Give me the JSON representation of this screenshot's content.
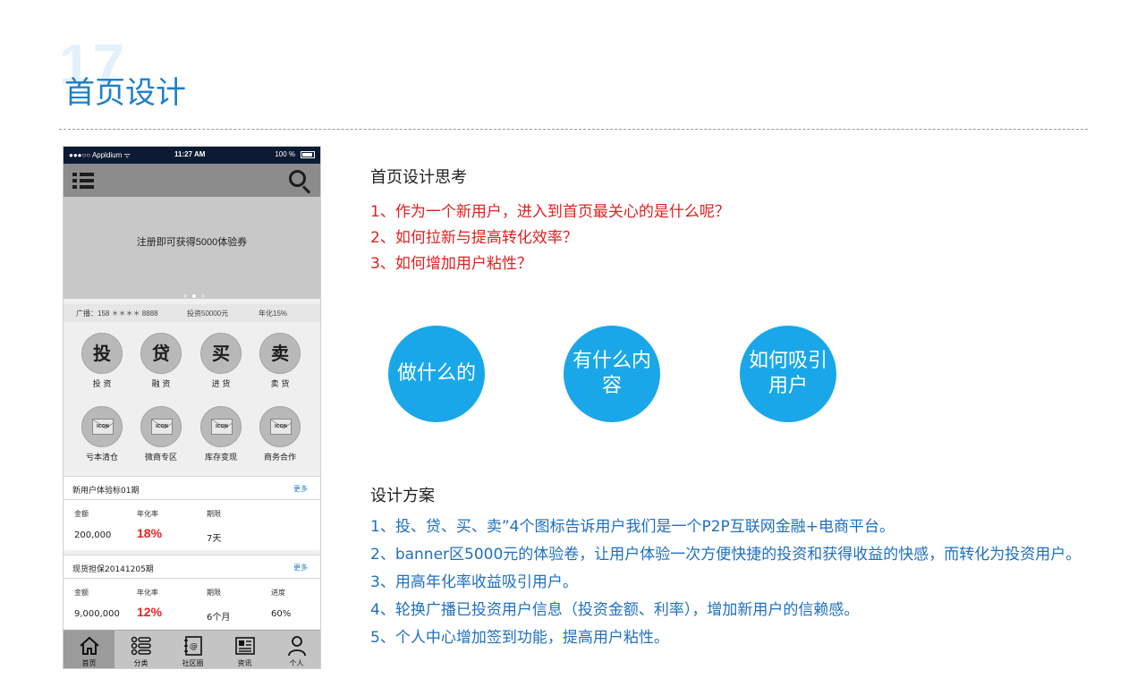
{
  "page": {
    "number": "17",
    "title": "首页设计"
  },
  "phone": {
    "status_bar": {
      "carrier": "●●●○○ Appldium ᯤ",
      "time": "11:27 AM",
      "battery": "100 %"
    },
    "header": {
      "menu_icon": "menu-icon",
      "search_icon": "search-icon"
    },
    "banner": {
      "text": "注册即可获得5000体验券",
      "dots": 3,
      "active_dot": 2
    },
    "broadcast": {
      "user": "广播：158 ＊＊＊＊ 8888",
      "amount": "投资50000元",
      "rate": "年化15%"
    },
    "grid": {
      "top": [
        {
          "glyph": "投",
          "label": "投 资"
        },
        {
          "glyph": "贷",
          "label": "融 资"
        },
        {
          "glyph": "买",
          "label": "进 货"
        },
        {
          "glyph": "卖",
          "label": "卖 货"
        }
      ],
      "bottom": [
        {
          "icon_text": "ICON",
          "label": "亏本清仓"
        },
        {
          "icon_text": "ICON",
          "label": "微商专区"
        },
        {
          "icon_text": "ICON",
          "label": "库存变现"
        },
        {
          "icon_text": "ICON",
          "label": "商务合作"
        }
      ]
    },
    "cards": [
      {
        "title": "新用户体验标01期",
        "more": "更多",
        "labels": [
          "金额",
          "年化率",
          "期限"
        ],
        "values": [
          "200,000",
          "18%",
          "7天"
        ]
      },
      {
        "title": "现货担保20141205期",
        "more": "更多",
        "labels": [
          "金额",
          "年化率",
          "期限",
          "进度"
        ],
        "values": [
          "9,000,000",
          "12%",
          "6个月",
          "60%"
        ]
      }
    ],
    "tabbar": [
      {
        "label": "首页",
        "icon": "home-icon",
        "active": true
      },
      {
        "label": "分类",
        "icon": "list-icon",
        "active": false
      },
      {
        "label": "社区圈",
        "icon": "community-icon",
        "active": false
      },
      {
        "label": "资讯",
        "icon": "news-icon",
        "active": false
      },
      {
        "label": "个人",
        "icon": "user-icon",
        "active": false
      }
    ]
  },
  "thinking": {
    "heading": "首页设计思考",
    "questions": [
      "1、作为一个新用户，进入到首页最关心的是什么呢？",
      "2、如何拉新与提高转化效率？",
      "3、如何增加用户粘性？"
    ]
  },
  "bubbles": [
    "做什么的",
    "有什么内容",
    "如何吸引用户"
  ],
  "plan": {
    "heading": "设计方案",
    "items": [
      "1、投、贷、买、卖”4个图标告诉用户我们是一个P2P互联网金融+电商平台。",
      "2、banner区5000元的体验卷，让用户体验一次方便快捷的投资和获得收益的快感，而转化为投资用户。",
      "3、用高年化率收益吸引用户。",
      "4、轮换广播已投资用户信息（投资金额、利率），增加新用户的信赖感。",
      "5、个人中心增加签到功能，提高用户粘性。"
    ]
  },
  "colors": {
    "title_blue": "#1e7fc9",
    "question_red": "#e02020",
    "plan_blue": "#1e6fc0",
    "bubble_blue": "#19a7ea",
    "rate_red": "#e52222"
  }
}
